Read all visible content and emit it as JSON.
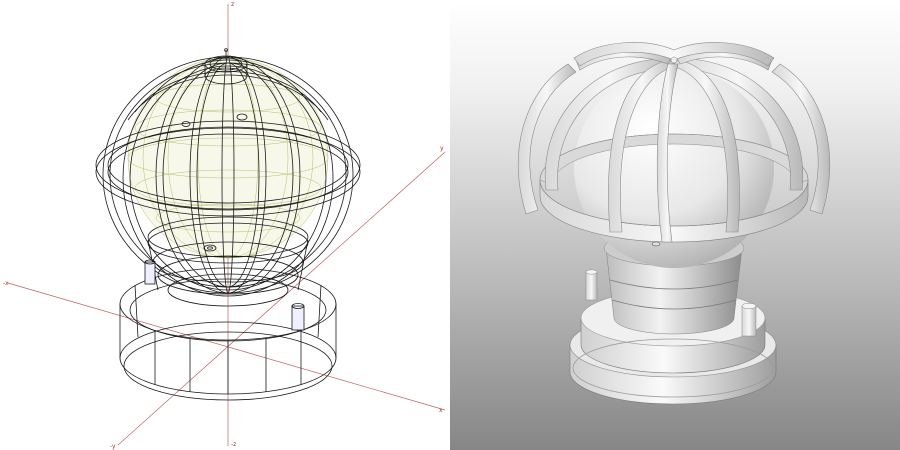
{
  "views": {
    "wireframe": {
      "axis_labels": {
        "z_top": "z",
        "z_bottom": "-z",
        "x_left": "-x",
        "x_right": "x",
        "y_right_upper": "y",
        "y_lower_left": "-y"
      }
    },
    "render": {}
  },
  "colors": {
    "wire_line": "#1a1a1a",
    "axis_line": "#c06060",
    "inner_globe": "#b9bf6e",
    "shaded_light": "#f4f4f4",
    "shaded_mid": "#d2d2d2",
    "shaded_dark": "#8e8e8e"
  },
  "icons": [
    "axis-gizmo",
    "wireframe-lamp",
    "shaded-lamp"
  ]
}
